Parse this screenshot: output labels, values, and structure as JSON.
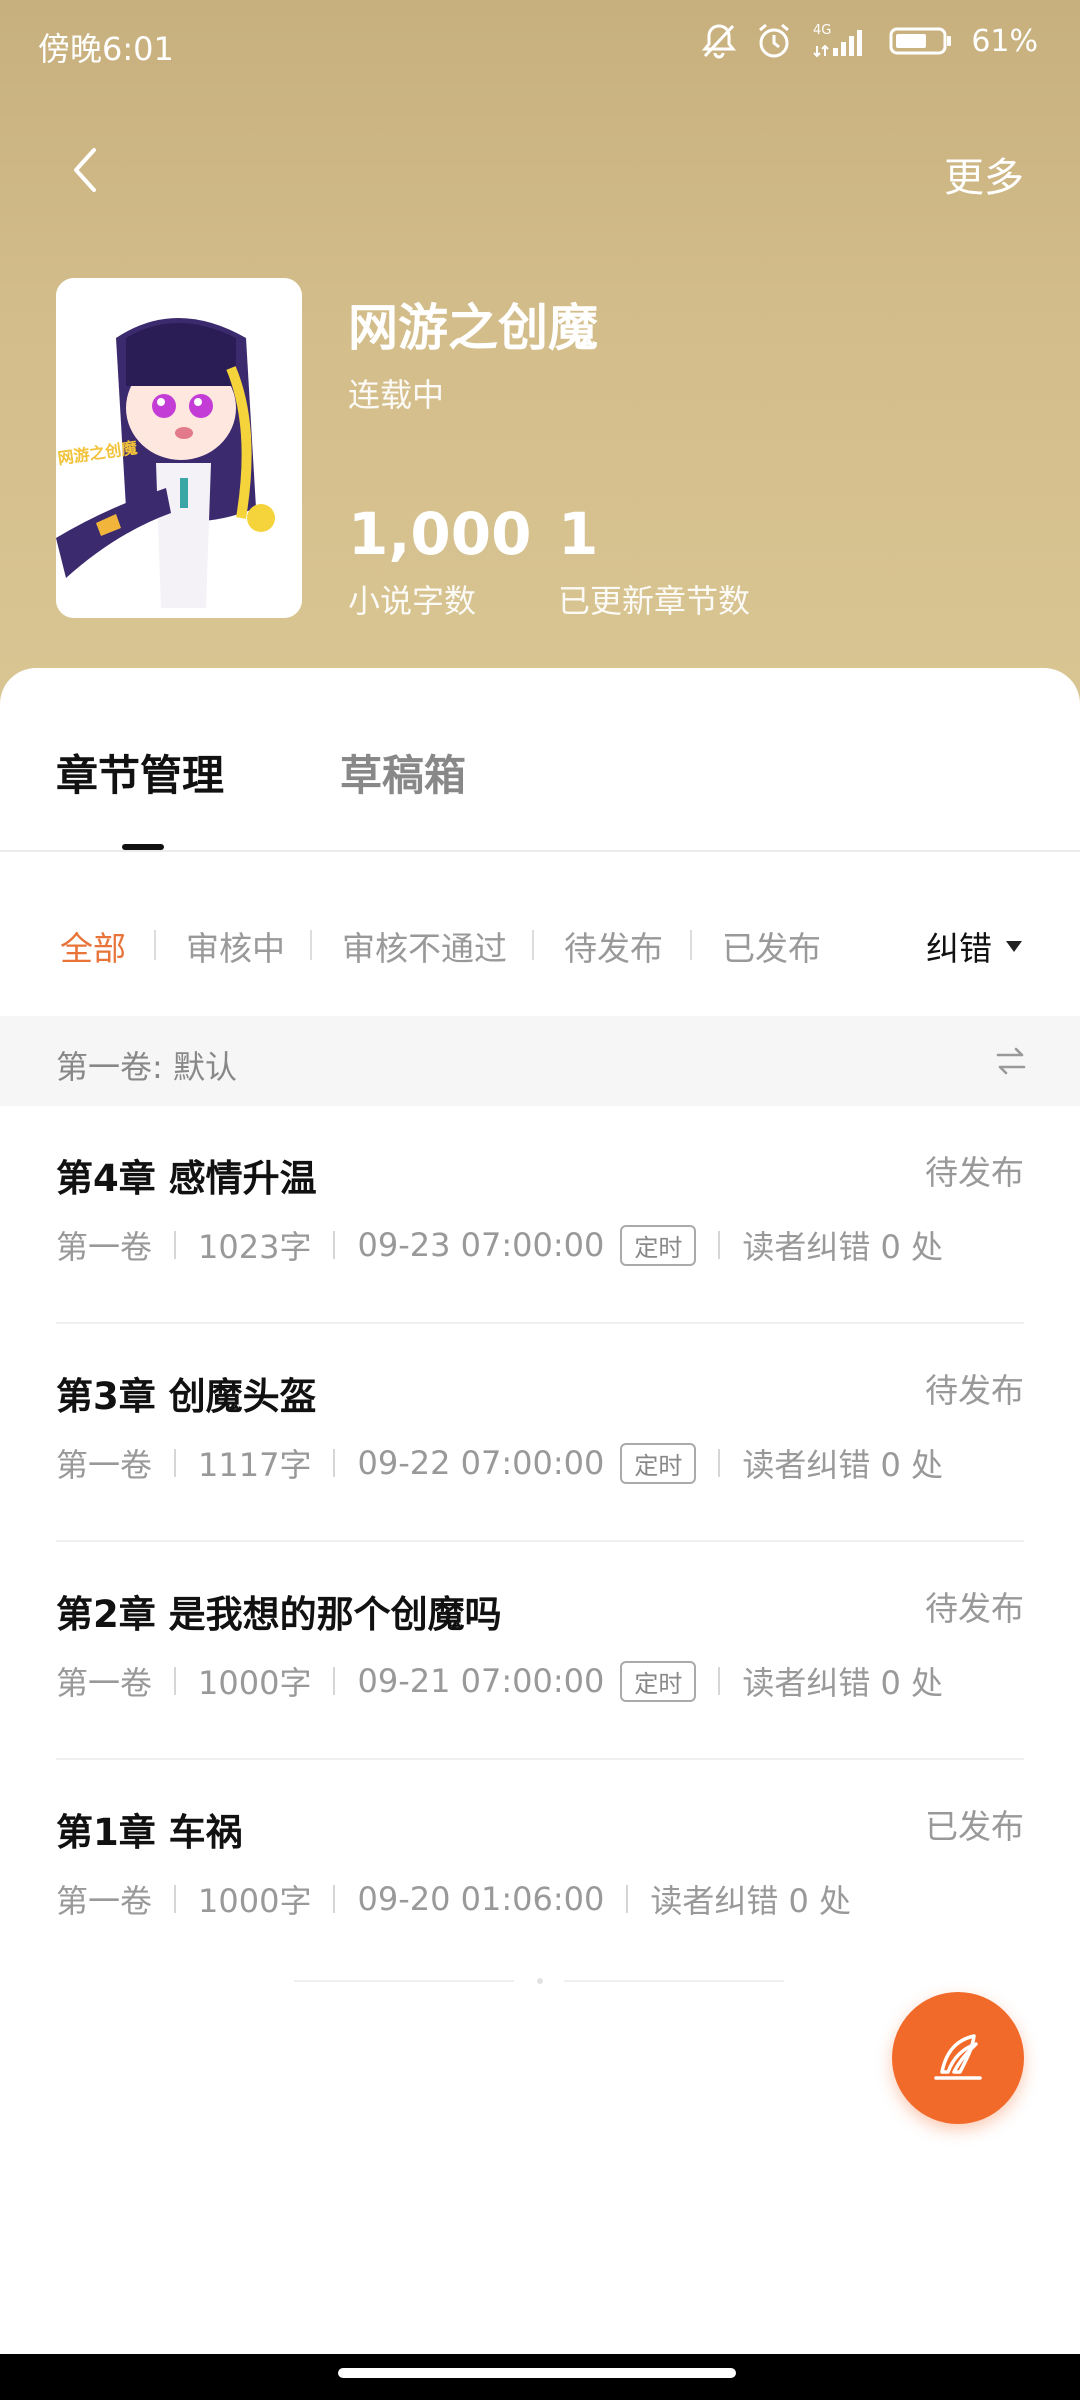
{
  "status_bar": {
    "time": "傍晚6:01",
    "network": "4G",
    "battery": "61%"
  },
  "nav": {
    "more_label": "更多"
  },
  "book": {
    "title": "网游之创魔",
    "status": "连载中",
    "cover_text": "网游之创魔",
    "word_count": "1,000",
    "word_count_label": "小说字数",
    "chapter_count": "1",
    "chapter_count_label": "已更新章节数"
  },
  "tabs": [
    {
      "label": "章节管理",
      "active": true
    },
    {
      "label": "草稿箱",
      "active": false
    }
  ],
  "filters": [
    {
      "label": "全部",
      "active": true
    },
    {
      "label": "审核中",
      "active": false
    },
    {
      "label": "审核不通过",
      "active": false
    },
    {
      "label": "待发布",
      "active": false
    },
    {
      "label": "已发布",
      "active": false
    }
  ],
  "sort_select": {
    "value": "纠错"
  },
  "volume": {
    "label": "第一卷: 默认"
  },
  "chapters": [
    {
      "title": "第4章 感情升温",
      "status": "待发布",
      "volume": "第一卷",
      "words": "1023字",
      "time": "09-23 07:00:00",
      "tag": "定时",
      "errata": "读者纠错 0 处"
    },
    {
      "title": "第3章 创魔头盔",
      "status": "待发布",
      "volume": "第一卷",
      "words": "1117字",
      "time": "09-22 07:00:00",
      "tag": "定时",
      "errata": "读者纠错 0 处"
    },
    {
      "title": "第2章 是我想的那个创魔吗",
      "status": "待发布",
      "volume": "第一卷",
      "words": "1000字",
      "time": "09-21 07:00:00",
      "tag": "定时",
      "errata": "读者纠错 0 处"
    },
    {
      "title": "第1章 车祸",
      "status": "已发布",
      "volume": "第一卷",
      "words": "1000字",
      "time": "09-20 01:06:00",
      "tag": "",
      "errata": "读者纠错 0 处"
    }
  ],
  "colors": {
    "header_gold": "#d3bd8b",
    "accent_orange": "#f26a2a",
    "filter_active": "#e8743a"
  },
  "icons": [
    "back-arrow-icon",
    "bell-muted-icon",
    "alarm-icon",
    "signal-icon",
    "battery-icon",
    "swap-icon",
    "dropdown-triangle-icon",
    "quill-icon"
  ]
}
